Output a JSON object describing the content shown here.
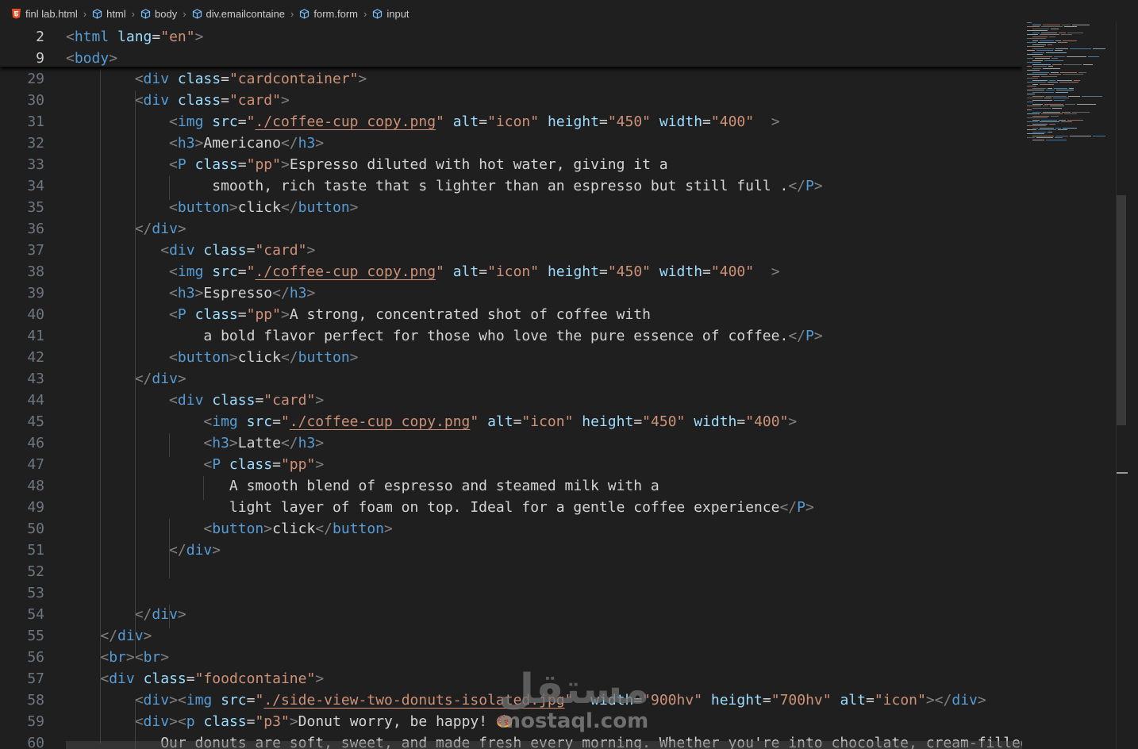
{
  "breadcrumb": {
    "items": [
      {
        "label": "finl lab.html",
        "icon": "html5-icon"
      },
      {
        "label": "html",
        "icon": "cube-icon"
      },
      {
        "label": "body",
        "icon": "cube-icon"
      },
      {
        "label": "div.emailcontaine",
        "icon": "cube-icon"
      },
      {
        "label": "form.form",
        "icon": "cube-icon"
      },
      {
        "label": "input",
        "icon": "cube-icon"
      }
    ]
  },
  "sticky": [
    {
      "n": "2",
      "tokens": [
        [
          "t",
          "<"
        ],
        [
          "tn",
          "html"
        ],
        [
          "tx",
          " "
        ],
        [
          "at",
          "lang"
        ],
        [
          "tx",
          "="
        ],
        [
          "sv",
          "\"en\""
        ],
        [
          "t",
          ">"
        ]
      ]
    },
    {
      "n": "9",
      "tokens": [
        [
          "t",
          "<"
        ],
        [
          "tn",
          "body"
        ],
        [
          "t",
          ">"
        ]
      ]
    }
  ],
  "lines": [
    {
      "n": "29",
      "tokens": [
        [
          "tx",
          "        "
        ],
        [
          "t",
          "<"
        ],
        [
          "tn",
          "div"
        ],
        [
          "tx",
          " "
        ],
        [
          "at",
          "class"
        ],
        [
          "tx",
          "="
        ],
        [
          "sv",
          "\"cardcontainer\""
        ],
        [
          "t",
          ">"
        ]
      ]
    },
    {
      "n": "30",
      "tokens": [
        [
          "tx",
          "        "
        ],
        [
          "t",
          "<"
        ],
        [
          "tn",
          "div"
        ],
        [
          "tx",
          " "
        ],
        [
          "at",
          "class"
        ],
        [
          "tx",
          "="
        ],
        [
          "sv",
          "\"card\""
        ],
        [
          "t",
          ">"
        ]
      ]
    },
    {
      "n": "31",
      "tokens": [
        [
          "tx",
          "            "
        ],
        [
          "t",
          "<"
        ],
        [
          "tn",
          "img"
        ],
        [
          "tx",
          " "
        ],
        [
          "at",
          "src"
        ],
        [
          "tx",
          "="
        ],
        [
          "sv",
          "\""
        ],
        [
          "svl",
          "./coffee-cup copy.png"
        ],
        [
          "sv",
          "\""
        ],
        [
          "tx",
          " "
        ],
        [
          "at",
          "alt"
        ],
        [
          "tx",
          "="
        ],
        [
          "sv",
          "\"icon\""
        ],
        [
          "tx",
          " "
        ],
        [
          "at",
          "height"
        ],
        [
          "tx",
          "="
        ],
        [
          "sv",
          "\"450\""
        ],
        [
          "tx",
          " "
        ],
        [
          "at",
          "width"
        ],
        [
          "tx",
          "="
        ],
        [
          "sv",
          "\"400\""
        ],
        [
          "tx",
          "  "
        ],
        [
          "t",
          ">"
        ]
      ]
    },
    {
      "n": "32",
      "tokens": [
        [
          "tx",
          "            "
        ],
        [
          "t",
          "<"
        ],
        [
          "tn",
          "h3"
        ],
        [
          "t",
          ">"
        ],
        [
          "tx",
          "Americano"
        ],
        [
          "t",
          "</"
        ],
        [
          "tn",
          "h3"
        ],
        [
          "t",
          ">"
        ]
      ]
    },
    {
      "n": "33",
      "tokens": [
        [
          "tx",
          "            "
        ],
        [
          "t",
          "<"
        ],
        [
          "tn",
          "P"
        ],
        [
          "tx",
          " "
        ],
        [
          "at",
          "class"
        ],
        [
          "tx",
          "="
        ],
        [
          "sv",
          "\"pp\""
        ],
        [
          "t",
          ">"
        ],
        [
          "tx",
          "Espresso diluted with hot water, giving it a"
        ]
      ]
    },
    {
      "n": "34",
      "tokens": [
        [
          "tx",
          "                 smooth, rich taste that s lighter than an espresso but still full ."
        ],
        [
          "t",
          "</"
        ],
        [
          "tn",
          "P"
        ],
        [
          "t",
          ">"
        ]
      ]
    },
    {
      "n": "35",
      "tokens": [
        [
          "tx",
          "            "
        ],
        [
          "t",
          "<"
        ],
        [
          "tn",
          "button"
        ],
        [
          "t",
          ">"
        ],
        [
          "tx",
          "click"
        ],
        [
          "t",
          "</"
        ],
        [
          "tn",
          "button"
        ],
        [
          "t",
          ">"
        ]
      ]
    },
    {
      "n": "36",
      "tokens": [
        [
          "tx",
          "        "
        ],
        [
          "t",
          "</"
        ],
        [
          "tn",
          "div"
        ],
        [
          "t",
          ">"
        ]
      ]
    },
    {
      "n": "37",
      "tokens": [
        [
          "tx",
          "           "
        ],
        [
          "t",
          "<"
        ],
        [
          "tn",
          "div"
        ],
        [
          "tx",
          " "
        ],
        [
          "at",
          "class"
        ],
        [
          "tx",
          "="
        ],
        [
          "sv",
          "\"card\""
        ],
        [
          "t",
          ">"
        ]
      ]
    },
    {
      "n": "38",
      "tokens": [
        [
          "tx",
          "            "
        ],
        [
          "t",
          "<"
        ],
        [
          "tn",
          "img"
        ],
        [
          "tx",
          " "
        ],
        [
          "at",
          "src"
        ],
        [
          "tx",
          "="
        ],
        [
          "sv",
          "\""
        ],
        [
          "svl",
          "./coffee-cup copy.png"
        ],
        [
          "sv",
          "\""
        ],
        [
          "tx",
          " "
        ],
        [
          "at",
          "alt"
        ],
        [
          "tx",
          "="
        ],
        [
          "sv",
          "\"icon\""
        ],
        [
          "tx",
          " "
        ],
        [
          "at",
          "height"
        ],
        [
          "tx",
          "="
        ],
        [
          "sv",
          "\"450\""
        ],
        [
          "tx",
          " "
        ],
        [
          "at",
          "width"
        ],
        [
          "tx",
          "="
        ],
        [
          "sv",
          "\"400\""
        ],
        [
          "tx",
          "  "
        ],
        [
          "t",
          ">"
        ]
      ]
    },
    {
      "n": "39",
      "tokens": [
        [
          "tx",
          "            "
        ],
        [
          "t",
          "<"
        ],
        [
          "tn",
          "h3"
        ],
        [
          "t",
          ">"
        ],
        [
          "tx",
          "Espresso"
        ],
        [
          "t",
          "</"
        ],
        [
          "tn",
          "h3"
        ],
        [
          "t",
          ">"
        ]
      ]
    },
    {
      "n": "40",
      "tokens": [
        [
          "tx",
          "            "
        ],
        [
          "t",
          "<"
        ],
        [
          "tn",
          "P"
        ],
        [
          "tx",
          " "
        ],
        [
          "at",
          "class"
        ],
        [
          "tx",
          "="
        ],
        [
          "sv",
          "\"pp\""
        ],
        [
          "t",
          ">"
        ],
        [
          "tx",
          "A strong, concentrated shot of coffee with"
        ]
      ]
    },
    {
      "n": "41",
      "tokens": [
        [
          "tx",
          "                a bold flavor perfect for those who love the pure essence of coffee."
        ],
        [
          "t",
          "</"
        ],
        [
          "tn",
          "P"
        ],
        [
          "t",
          ">"
        ]
      ]
    },
    {
      "n": "42",
      "tokens": [
        [
          "tx",
          "            "
        ],
        [
          "t",
          "<"
        ],
        [
          "tn",
          "button"
        ],
        [
          "t",
          ">"
        ],
        [
          "tx",
          "click"
        ],
        [
          "t",
          "</"
        ],
        [
          "tn",
          "button"
        ],
        [
          "t",
          ">"
        ]
      ]
    },
    {
      "n": "43",
      "tokens": [
        [
          "tx",
          "        "
        ],
        [
          "t",
          "</"
        ],
        [
          "tn",
          "div"
        ],
        [
          "t",
          ">"
        ]
      ]
    },
    {
      "n": "44",
      "tokens": [
        [
          "tx",
          "            "
        ],
        [
          "t",
          "<"
        ],
        [
          "tn",
          "div"
        ],
        [
          "tx",
          " "
        ],
        [
          "at",
          "class"
        ],
        [
          "tx",
          "="
        ],
        [
          "sv",
          "\"card\""
        ],
        [
          "t",
          ">"
        ]
      ]
    },
    {
      "n": "45",
      "tokens": [
        [
          "tx",
          "                "
        ],
        [
          "t",
          "<"
        ],
        [
          "tn",
          "img"
        ],
        [
          "tx",
          " "
        ],
        [
          "at",
          "src"
        ],
        [
          "tx",
          "="
        ],
        [
          "sv",
          "\""
        ],
        [
          "svl",
          "./coffee-cup copy.png"
        ],
        [
          "sv",
          "\""
        ],
        [
          "tx",
          " "
        ],
        [
          "at",
          "alt"
        ],
        [
          "tx",
          "="
        ],
        [
          "sv",
          "\"icon\""
        ],
        [
          "tx",
          " "
        ],
        [
          "at",
          "height"
        ],
        [
          "tx",
          "="
        ],
        [
          "sv",
          "\"450\""
        ],
        [
          "tx",
          " "
        ],
        [
          "at",
          "width"
        ],
        [
          "tx",
          "="
        ],
        [
          "sv",
          "\"400\""
        ],
        [
          "t",
          ">"
        ]
      ]
    },
    {
      "n": "46",
      "tokens": [
        [
          "tx",
          "                "
        ],
        [
          "t",
          "<"
        ],
        [
          "tn",
          "h3"
        ],
        [
          "t",
          ">"
        ],
        [
          "tx",
          "Latte"
        ],
        [
          "t",
          "</"
        ],
        [
          "tn",
          "h3"
        ],
        [
          "t",
          ">"
        ]
      ]
    },
    {
      "n": "47",
      "tokens": [
        [
          "tx",
          "                "
        ],
        [
          "t",
          "<"
        ],
        [
          "tn",
          "P"
        ],
        [
          "tx",
          " "
        ],
        [
          "at",
          "class"
        ],
        [
          "tx",
          "="
        ],
        [
          "sv",
          "\"pp\""
        ],
        [
          "t",
          ">"
        ]
      ]
    },
    {
      "n": "48",
      "tokens": [
        [
          "tx",
          "                   A smooth blend of espresso and steamed milk with a"
        ]
      ]
    },
    {
      "n": "49",
      "tokens": [
        [
          "tx",
          "                   light layer of foam on top. Ideal for a gentle coffee experience"
        ],
        [
          "t",
          "</"
        ],
        [
          "tn",
          "P"
        ],
        [
          "t",
          ">"
        ]
      ]
    },
    {
      "n": "50",
      "tokens": [
        [
          "tx",
          "                "
        ],
        [
          "t",
          "<"
        ],
        [
          "tn",
          "button"
        ],
        [
          "t",
          ">"
        ],
        [
          "tx",
          "click"
        ],
        [
          "t",
          "</"
        ],
        [
          "tn",
          "button"
        ],
        [
          "t",
          ">"
        ]
      ]
    },
    {
      "n": "51",
      "tokens": [
        [
          "tx",
          "            "
        ],
        [
          "t",
          "</"
        ],
        [
          "tn",
          "div"
        ],
        [
          "t",
          ">"
        ]
      ]
    },
    {
      "n": "52",
      "tokens": []
    },
    {
      "n": "53",
      "tokens": []
    },
    {
      "n": "54",
      "tokens": [
        [
          "tx",
          "        "
        ],
        [
          "t",
          "</"
        ],
        [
          "tn",
          "div"
        ],
        [
          "t",
          ">"
        ]
      ]
    },
    {
      "n": "55",
      "tokens": [
        [
          "tx",
          "    "
        ],
        [
          "t",
          "</"
        ],
        [
          "tn",
          "div"
        ],
        [
          "t",
          ">"
        ]
      ]
    },
    {
      "n": "56",
      "tokens": [
        [
          "tx",
          "    "
        ],
        [
          "t",
          "<"
        ],
        [
          "tn",
          "br"
        ],
        [
          "t",
          "><"
        ],
        [
          "tn",
          "br"
        ],
        [
          "t",
          ">"
        ]
      ]
    },
    {
      "n": "57",
      "tokens": [
        [
          "tx",
          "    "
        ],
        [
          "t",
          "<"
        ],
        [
          "tn",
          "div"
        ],
        [
          "tx",
          " "
        ],
        [
          "at",
          "class"
        ],
        [
          "tx",
          "="
        ],
        [
          "sv",
          "\"foodcontaine\""
        ],
        [
          "t",
          ">"
        ]
      ]
    },
    {
      "n": "58",
      "tokens": [
        [
          "tx",
          "        "
        ],
        [
          "t",
          "<"
        ],
        [
          "tn",
          "div"
        ],
        [
          "t",
          "><"
        ],
        [
          "tn",
          "img"
        ],
        [
          "tx",
          " "
        ],
        [
          "at",
          "src"
        ],
        [
          "tx",
          "="
        ],
        [
          "sv",
          "\""
        ],
        [
          "svl",
          "./side-view-two-donuts-isolated.jpg"
        ],
        [
          "sv",
          "\""
        ],
        [
          "tx",
          "  "
        ],
        [
          "at",
          "width"
        ],
        [
          "tx",
          "="
        ],
        [
          "sv",
          "\"900hv\""
        ],
        [
          "tx",
          " "
        ],
        [
          "at",
          "height"
        ],
        [
          "tx",
          "="
        ],
        [
          "sv",
          "\"700hv\""
        ],
        [
          "tx",
          " "
        ],
        [
          "at",
          "alt"
        ],
        [
          "tx",
          "="
        ],
        [
          "sv",
          "\"icon\""
        ],
        [
          "t",
          "></"
        ],
        [
          "tn",
          "div"
        ],
        [
          "t",
          ">"
        ]
      ]
    },
    {
      "n": "59",
      "tokens": [
        [
          "tx",
          "        "
        ],
        [
          "t",
          "<"
        ],
        [
          "tn",
          "div"
        ],
        [
          "t",
          "><"
        ],
        [
          "tn",
          "p"
        ],
        [
          "tx",
          " "
        ],
        [
          "at",
          "class"
        ],
        [
          "tx",
          "="
        ],
        [
          "sv",
          "\"p3\""
        ],
        [
          "t",
          ">"
        ],
        [
          "tx",
          "Donut worry, be happy! 🍩"
        ]
      ]
    },
    {
      "n": "60",
      "tokens": [
        [
          "tx",
          "           Our donuts are soft, sweet, and made fresh every morning. Whether you're into chocolate, cream-filled,"
        ]
      ]
    }
  ],
  "watermark": {
    "logo": "مستقل",
    "url": "mostaql.com"
  },
  "colors": {
    "background": "#1f1f1f",
    "tag_punct": "#808080",
    "tag_name": "#569cd6",
    "attr": "#9cdcfe",
    "string": "#ce9178",
    "text": "#d4d4d4",
    "line_number": "#6e7681"
  }
}
